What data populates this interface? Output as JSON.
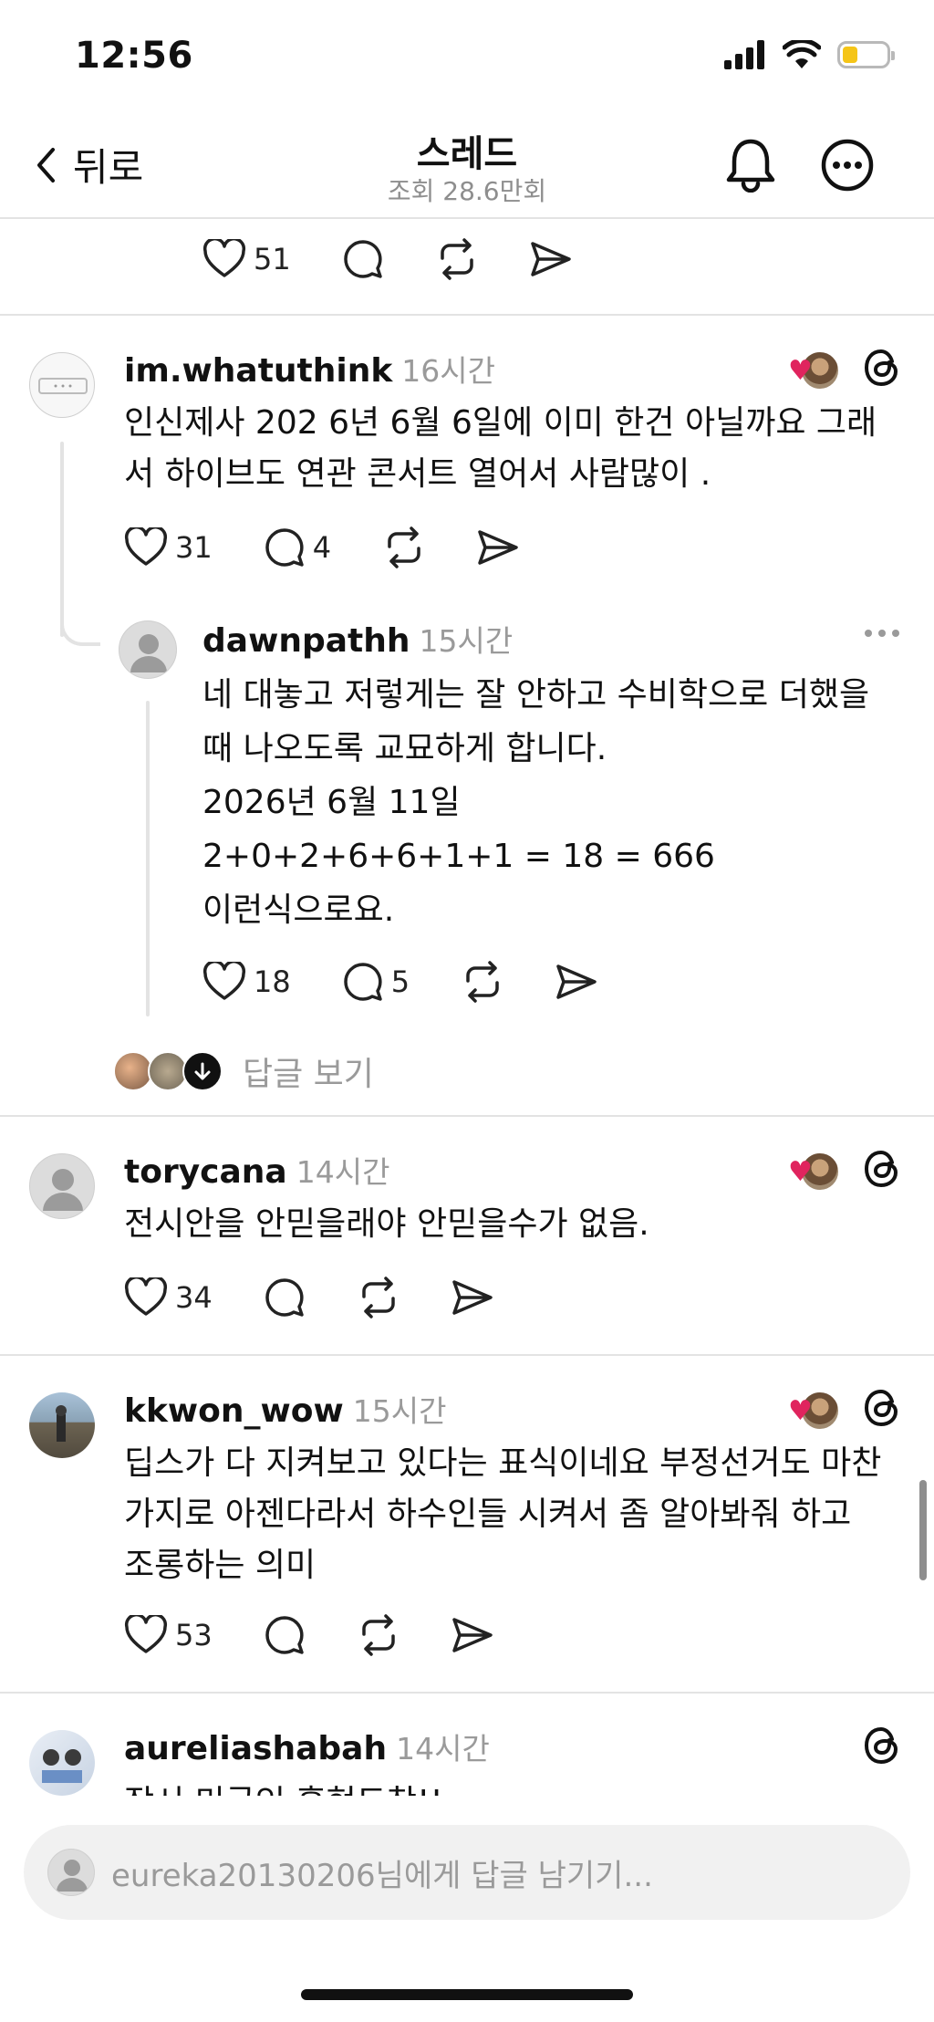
{
  "status_bar": {
    "time": "12:56",
    "battery_level": 0.25
  },
  "header": {
    "back_label": "뒤로",
    "title": "스레드",
    "views": "조회 28.6만회"
  },
  "top_post": {
    "likes": "51"
  },
  "comments": [
    {
      "username": "im.whatuthink",
      "time": "16시간",
      "lines": [
        "인신제사 202  6년 6월 6일에 이미 한건 아닐까요 그래",
        "서 하이브도 연관 콘서트 열어서 사람많이 ."
      ],
      "likes": "31",
      "replies": "4"
    },
    {
      "username": "dawnpathh",
      "time": "15시간",
      "lines": [
        "네 대놓고 저렇게는 잘 안하고 수비학으로 더했을",
        "때 나오도록 교묘하게 합니다.",
        "2026년 6월 11일",
        "2+0+2+6+6+1+1 = 18 = 666",
        "이런식으로요."
      ],
      "likes": "18",
      "replies": "5"
    },
    {
      "username": "torycana",
      "time": "14시간",
      "lines": [
        "전시안을 안믿을래야 안믿을수가 없음."
      ],
      "likes": "34"
    },
    {
      "username": "kkwon_wow",
      "time": "15시간",
      "lines": [
        "딥스가 다 지켜보고 있다는 표식이네요 부정선거도 마찬",
        "가지로 아젠다라서 하수인들 시켜서 좀 알아봐줘 하고",
        "조롱하는 의미"
      ],
      "likes": "53"
    },
    {
      "username": "aureliashabah",
      "time": "14시간",
      "lines": [
        "잠시 미국인 홍현도착!!"
      ]
    }
  ],
  "view_replies": "답글 보기",
  "reply_placeholder": "eureka20130206님에게 답글 남기기...",
  "icons": {
    "back": "chevron-left-icon",
    "bell": "bell-icon",
    "more": "more-circle-icon",
    "like": "heart-icon",
    "reply": "comment-icon",
    "repost": "repost-icon",
    "share": "send-icon",
    "threads": "threads-logo-icon"
  },
  "colors": {
    "accent_heart": "#e0245e",
    "battery": "#f5c518",
    "muted": "#9a9a9a"
  }
}
